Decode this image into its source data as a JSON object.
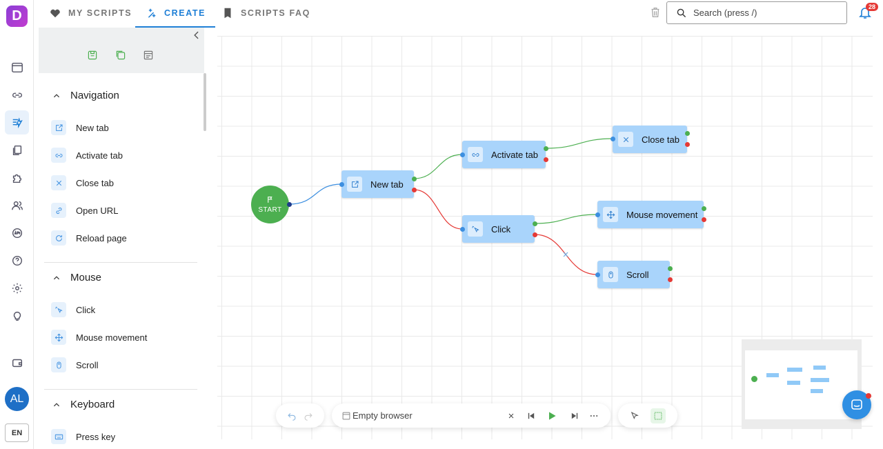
{
  "app": {
    "logo_letter": "D",
    "brand_color": "#9b3fd8"
  },
  "tabs": [
    {
      "label": "MY SCRIPTS",
      "icon": "heart-icon"
    },
    {
      "label": "CREATE",
      "icon": "sparkle-icon",
      "active": true
    },
    {
      "label": "SCRIPTS FAQ",
      "icon": "book-icon"
    }
  ],
  "search": {
    "placeholder": "Search (press /)"
  },
  "notifications": {
    "count": "28"
  },
  "user": {
    "initials": "AL",
    "language": "EN"
  },
  "sidebar": {
    "sections": [
      {
        "title": "Navigation",
        "items": [
          "New tab",
          "Activate tab",
          "Close tab",
          "Open URL",
          "Reload page"
        ]
      },
      {
        "title": "Mouse",
        "items": [
          "Click",
          "Mouse movement",
          "Scroll"
        ]
      },
      {
        "title": "Keyboard",
        "items": [
          "Press key"
        ]
      }
    ]
  },
  "flow": {
    "start_label": "START",
    "nodes": {
      "new_tab": "New tab",
      "activate_tab": "Activate tab",
      "close_tab": "Close tab",
      "click": "Click",
      "mouse_movement": "Mouse movement",
      "scroll": "Scroll"
    }
  },
  "player": {
    "browser_label": "Empty browser"
  },
  "colors": {
    "accent": "#1e7fd6",
    "node": "#a9d4fb",
    "start": "#4caf50",
    "success_link": "#4caf50",
    "error_link": "#e53935"
  }
}
